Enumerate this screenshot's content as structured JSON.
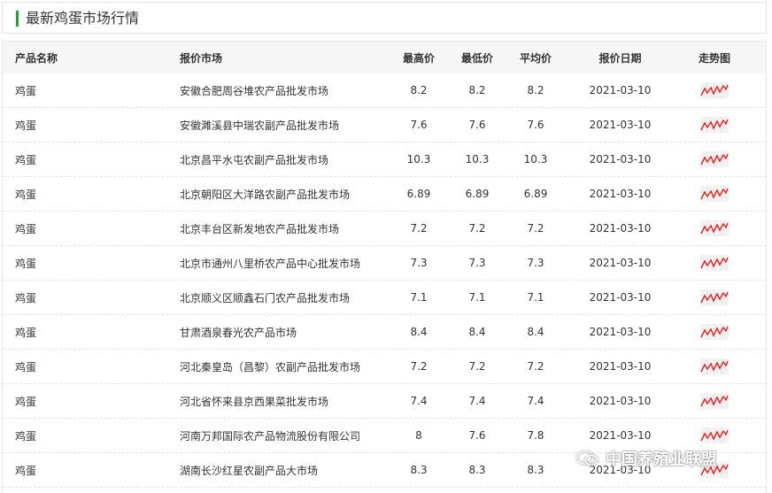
{
  "section_title": "最新鸡蛋市场行情",
  "table": {
    "headers": [
      "产品名称",
      "报价市场",
      "最高价",
      "最低价",
      "平均价",
      "报价日期",
      "走势图"
    ],
    "rows": [
      {
        "product": "鸡蛋",
        "market": "安徽合肥周谷堆农产品批发市场",
        "max": "8.2",
        "min": "8.2",
        "avg": "8.2",
        "date": "2021-03-10"
      },
      {
        "product": "鸡蛋",
        "market": "安徽濉溪县中瑞农副产品批发市场",
        "max": "7.6",
        "min": "7.6",
        "avg": "7.6",
        "date": "2021-03-10"
      },
      {
        "product": "鸡蛋",
        "market": "北京昌平水屯农副产品批发市场",
        "max": "10.3",
        "min": "10.3",
        "avg": "10.3",
        "date": "2021-03-10"
      },
      {
        "product": "鸡蛋",
        "market": "北京朝阳区大洋路农副产品批发市场",
        "max": "6.89",
        "min": "6.89",
        "avg": "6.89",
        "date": "2021-03-10"
      },
      {
        "product": "鸡蛋",
        "market": "北京丰台区新发地农产品批发市场",
        "max": "7.2",
        "min": "7.2",
        "avg": "7.2",
        "date": "2021-03-10"
      },
      {
        "product": "鸡蛋",
        "market": "北京市通州八里桥农产品中心批发市场",
        "max": "7.3",
        "min": "7.3",
        "avg": "7.3",
        "date": "2021-03-10"
      },
      {
        "product": "鸡蛋",
        "market": "北京顺义区顺鑫石门农产品批发市场",
        "max": "7.1",
        "min": "7.1",
        "avg": "7.1",
        "date": "2021-03-10"
      },
      {
        "product": "鸡蛋",
        "market": "甘肃酒泉春光农产品市场",
        "max": "8.4",
        "min": "8.4",
        "avg": "8.4",
        "date": "2021-03-10"
      },
      {
        "product": "鸡蛋",
        "market": "河北秦皇岛（昌黎）农副产品批发市场",
        "max": "7.2",
        "min": "7.2",
        "avg": "7.2",
        "date": "2021-03-10"
      },
      {
        "product": "鸡蛋",
        "market": "河北省怀来县京西果菜批发市场",
        "max": "7.4",
        "min": "7.4",
        "avg": "7.4",
        "date": "2021-03-10"
      },
      {
        "product": "鸡蛋",
        "market": "河南万邦国际农产品物流股份有限公司",
        "max": "8",
        "min": "7.6",
        "avg": "7.8",
        "date": "2021-03-10"
      },
      {
        "product": "鸡蛋",
        "market": "湖南长沙红星农副产品大市场",
        "max": "8.3",
        "min": "8.3",
        "avg": "8.3",
        "date": "2021-03-10"
      }
    ]
  },
  "trend_icon": "trend-line-icon",
  "colors": {
    "accent": "#22a336",
    "trend": "#e02020",
    "header_bg": "#f6f6f6"
  },
  "watermark": "中国养殖业联盟",
  "watermark_icon": "wechat-icon"
}
